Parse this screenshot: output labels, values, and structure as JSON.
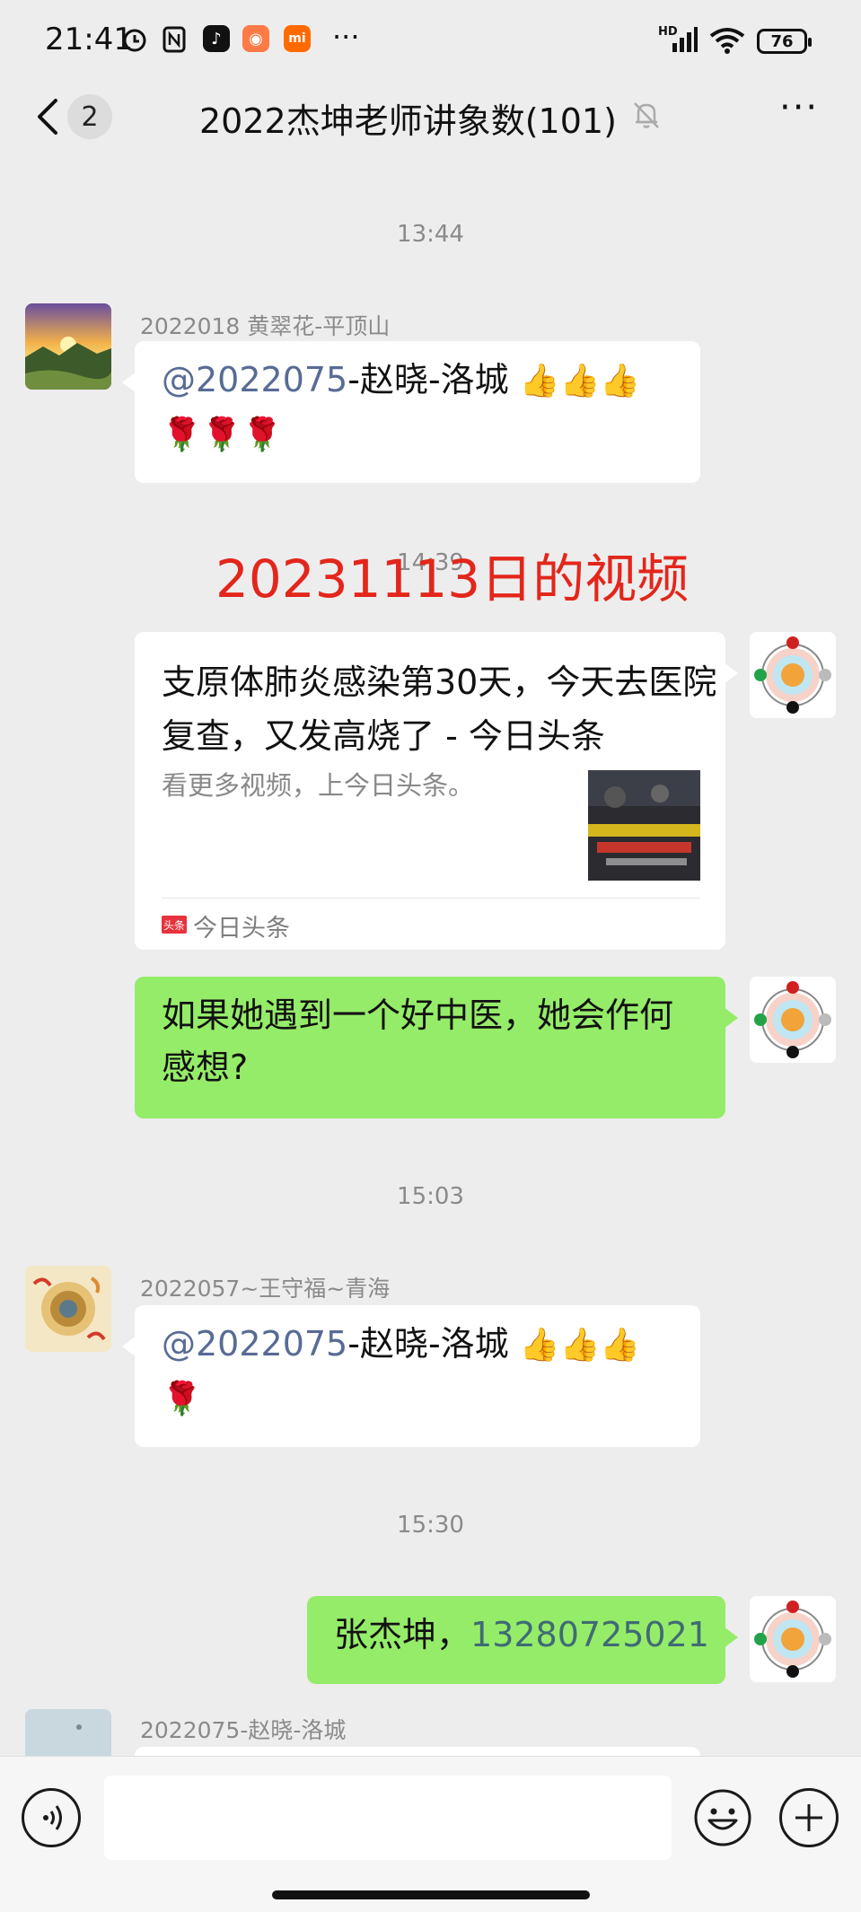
{
  "status_bar": {
    "time": "21:41",
    "network": "HD",
    "battery": "76",
    "more": "···"
  },
  "header": {
    "back_badge": "2",
    "title": "2022杰坤老师讲象数(101)",
    "more_label": "···"
  },
  "overlay_text": "20231113日的视频",
  "messages": [
    {
      "type": "timestamp",
      "text": "13:44"
    },
    {
      "sender": "2022018 黄翠花-平顶山",
      "mention": "@2022075",
      "text": "-赵晓-洛城",
      "emoji_line1": "👍👍👍",
      "emoji_line2": "🌹🌹🌹"
    },
    {
      "type": "timestamp",
      "text": "14:39"
    },
    {
      "card": {
        "title": "支原体肺炎感染第30天，今天去医院复查，又发高烧了 - 今日头条",
        "description": "看更多视频，上今日头条。",
        "source": "今日头条",
        "source_badge": "头条"
      }
    },
    {
      "text": "如果她遇到一个好中医，她会作何感想?"
    },
    {
      "type": "timestamp",
      "text": "15:03"
    },
    {
      "sender": "2022057~王守福~青海",
      "mention": "@2022075",
      "text": "-赵晓-洛城",
      "emoji_line1": "👍👍👍",
      "emoji_line2": "🌹"
    },
    {
      "type": "timestamp",
      "text": "15:30"
    },
    {
      "name_text": "张杰坤，",
      "phone": "13280725021"
    },
    {
      "sender": "2022075-赵晓-洛城"
    }
  ],
  "colors": {
    "background": "#ededed",
    "own_bubble": "#95ec69",
    "other_bubble": "#ffffff",
    "mention": "#576b95",
    "overlay_red": "#e3261b"
  }
}
